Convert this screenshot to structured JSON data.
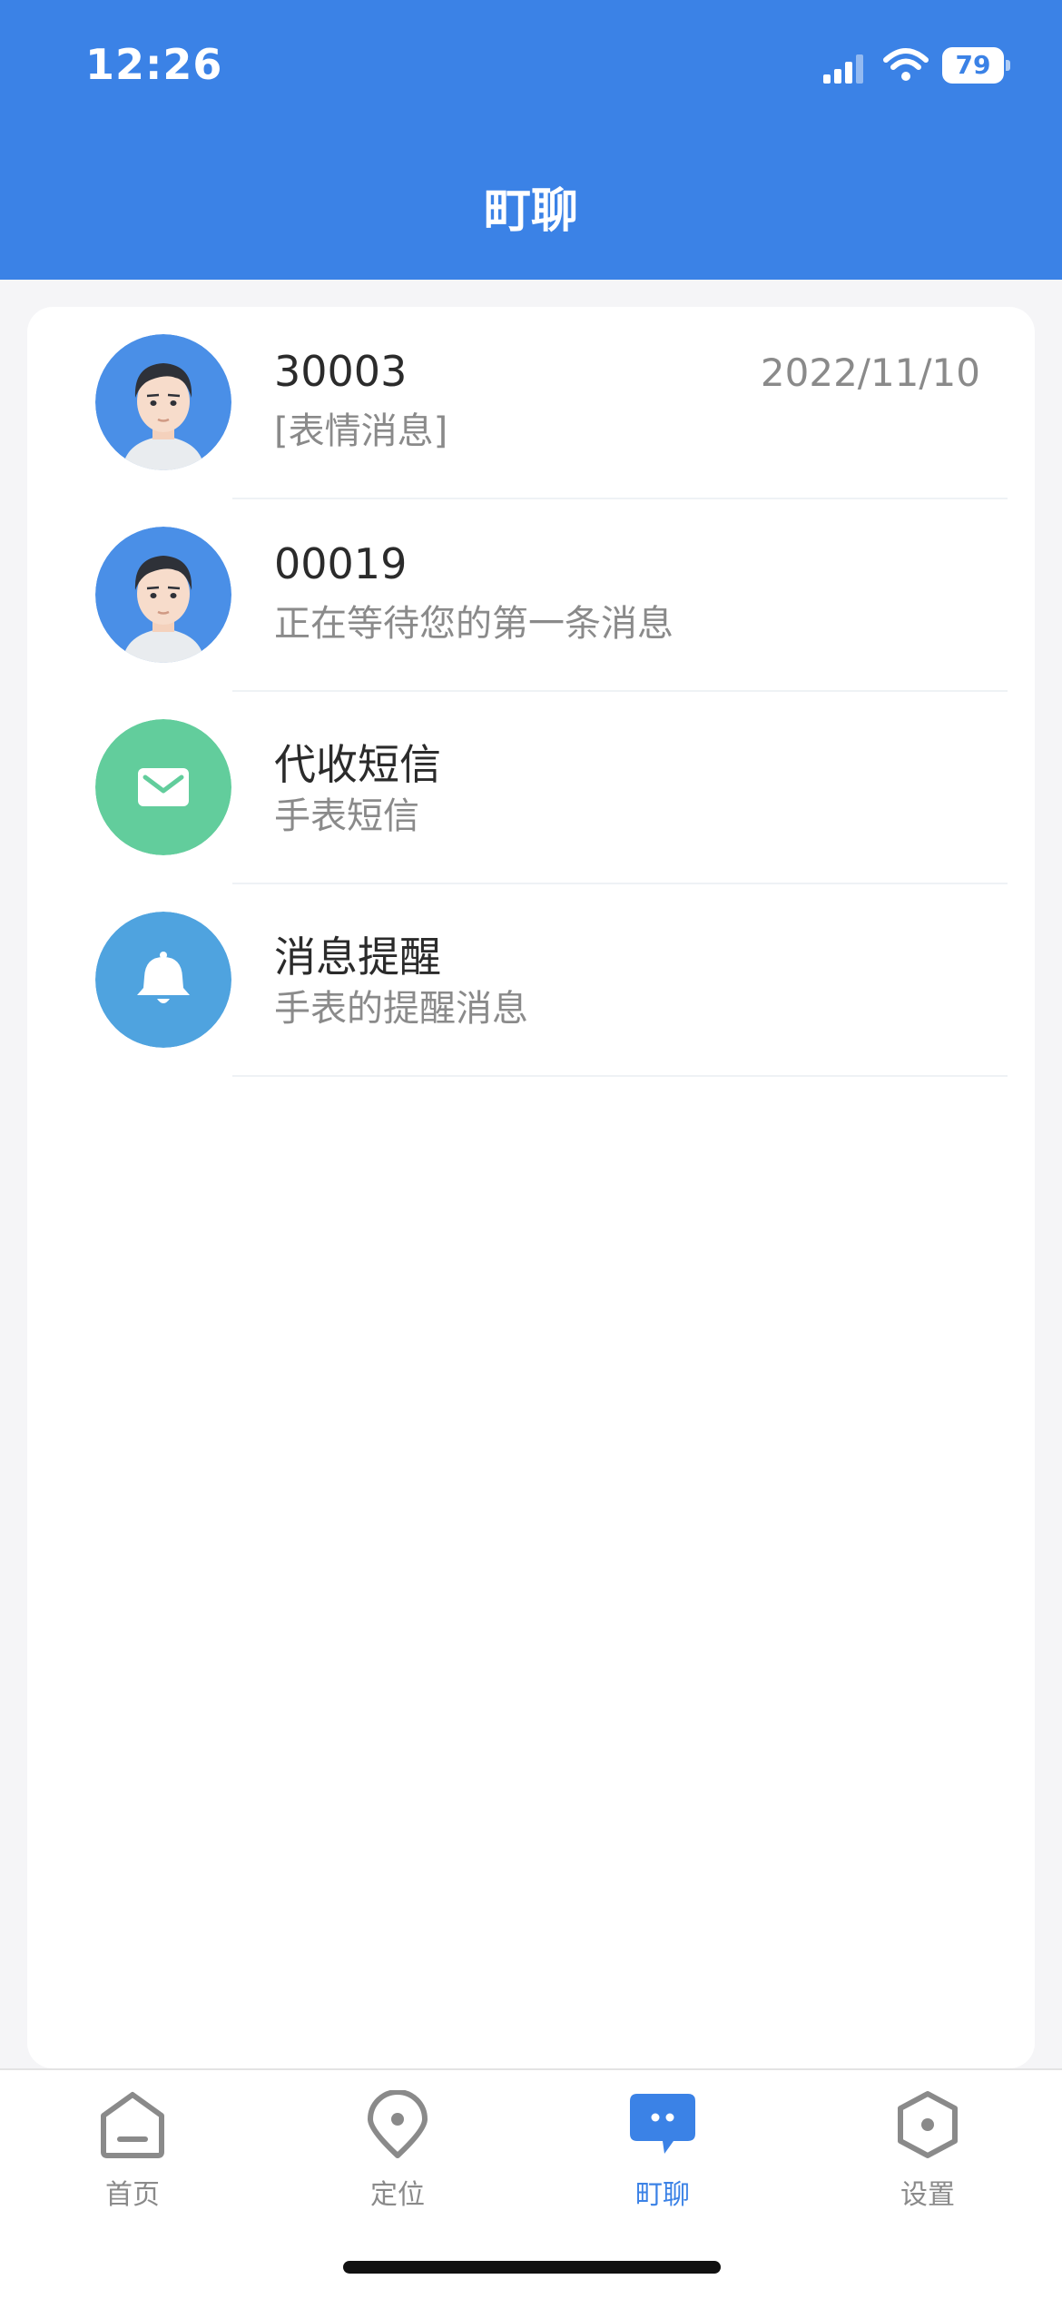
{
  "status_bar": {
    "time": "12:26",
    "battery": "79"
  },
  "header": {
    "title": "町聊"
  },
  "conversations": [
    {
      "title": "30003",
      "subtitle": "[表情消息]",
      "time": "2022/11/10",
      "avatar": "boy-avatar-icon"
    },
    {
      "title": "00019",
      "subtitle": "正在等待您的第一条消息",
      "time": "",
      "avatar": "boy-avatar-icon"
    },
    {
      "title": "代收短信",
      "subtitle": "手表短信",
      "time": "",
      "avatar": "envelope-icon",
      "color": "#62cd9c"
    },
    {
      "title": "消息提醒",
      "subtitle": "手表的提醒消息",
      "time": "",
      "avatar": "bell-icon",
      "color": "#4fa3df"
    }
  ],
  "tabbar": {
    "tabs": [
      {
        "label": "首页",
        "icon": "home-icon",
        "active": false
      },
      {
        "label": "定位",
        "icon": "location-pin-icon",
        "active": false
      },
      {
        "label": "町聊",
        "icon": "chat-bubble-icon",
        "active": true
      },
      {
        "label": "设置",
        "icon": "settings-hexagon-icon",
        "active": false
      }
    ]
  },
  "colors": {
    "primary": "#3b82e6",
    "green": "#62cd9c",
    "blue": "#4fa3df"
  }
}
